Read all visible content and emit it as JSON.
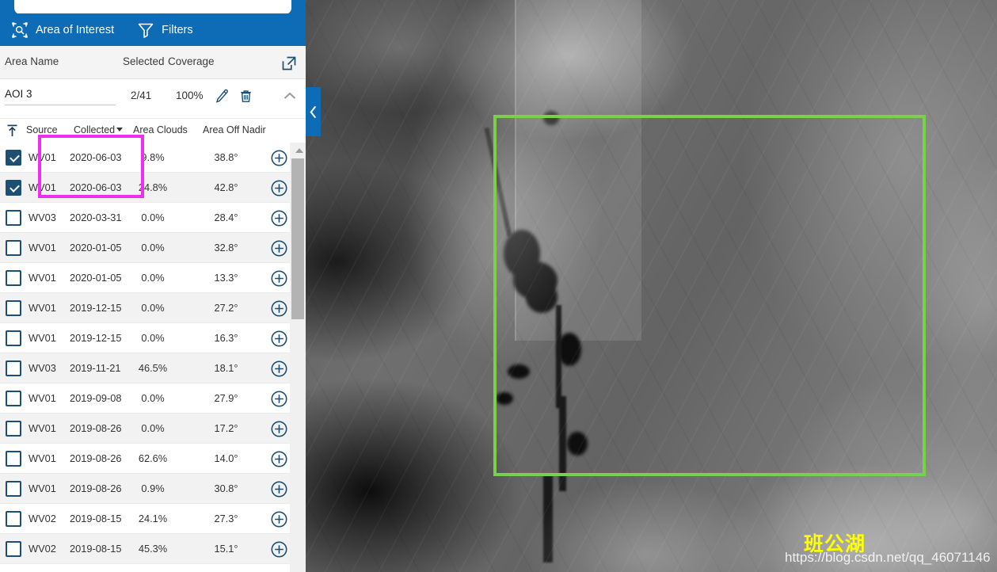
{
  "panel": {
    "header": {
      "aoi_label": "Area of Interest",
      "aoi_icon": "area-of-interest-icon",
      "filters_label": "Filters",
      "filters_icon": "filter-funnel-icon",
      "background_color": "#0d6cb5"
    },
    "aoi_columns": {
      "area_name": "Area Name",
      "selected": "Selected",
      "coverage": "Coverage",
      "popout_icon": "external-link-icon"
    },
    "aoi_entry": {
      "name": "AOI 3",
      "selected": "2/41",
      "coverage": "100%",
      "edit_icon": "pencil-icon",
      "delete_icon": "trash-icon",
      "collapse_icon": "chevron-up-icon"
    },
    "table": {
      "sort_icon": "sort-ascending-icon",
      "columns": {
        "source": "Source",
        "collected": "Collected",
        "area_clouds": "Area Clouds",
        "area_off_nadir": "Area Off Nadir"
      },
      "sorted_by": "Collected",
      "sort_direction": "desc",
      "add_icon": "plus-circle-icon",
      "rows": [
        {
          "checked": true,
          "source": "WV01",
          "collected": "2020-06-03",
          "clouds": "9.8%",
          "nadir": "38.8°"
        },
        {
          "checked": true,
          "source": "WV01",
          "collected": "2020-06-03",
          "clouds": "24.8%",
          "nadir": "42.8°"
        },
        {
          "checked": false,
          "source": "WV03",
          "collected": "2020-03-31",
          "clouds": "0.0%",
          "nadir": "28.4°"
        },
        {
          "checked": false,
          "source": "WV01",
          "collected": "2020-01-05",
          "clouds": "0.0%",
          "nadir": "32.8°"
        },
        {
          "checked": false,
          "source": "WV01",
          "collected": "2020-01-05",
          "clouds": "0.0%",
          "nadir": "13.3°"
        },
        {
          "checked": false,
          "source": "WV01",
          "collected": "2019-12-15",
          "clouds": "0.0%",
          "nadir": "27.2°"
        },
        {
          "checked": false,
          "source": "WV01",
          "collected": "2019-12-15",
          "clouds": "0.0%",
          "nadir": "16.3°"
        },
        {
          "checked": false,
          "source": "WV03",
          "collected": "2019-11-21",
          "clouds": "46.5%",
          "nadir": "18.1°"
        },
        {
          "checked": false,
          "source": "WV01",
          "collected": "2019-09-08",
          "clouds": "0.0%",
          "nadir": "27.9°"
        },
        {
          "checked": false,
          "source": "WV01",
          "collected": "2019-08-26",
          "clouds": "0.0%",
          "nadir": "17.2°"
        },
        {
          "checked": false,
          "source": "WV01",
          "collected": "2019-08-26",
          "clouds": "62.6%",
          "nadir": "14.0°"
        },
        {
          "checked": false,
          "source": "WV01",
          "collected": "2019-08-26",
          "clouds": "0.9%",
          "nadir": "30.8°"
        },
        {
          "checked": false,
          "source": "WV02",
          "collected": "2019-08-15",
          "clouds": "24.1%",
          "nadir": "27.3°"
        },
        {
          "checked": false,
          "source": "WV02",
          "collected": "2019-08-15",
          "clouds": "45.3%",
          "nadir": "15.1°"
        }
      ]
    }
  },
  "map": {
    "collapse_handle_icon": "chevron-left-icon",
    "aoi_footprint_color": "#79d14a",
    "annotation_box_color": "#ef2fef",
    "watermark_label": "班公湖",
    "watermark_label_color": "#ffff00",
    "watermark_url": "https://blog.csdn.net/qq_46071146"
  }
}
